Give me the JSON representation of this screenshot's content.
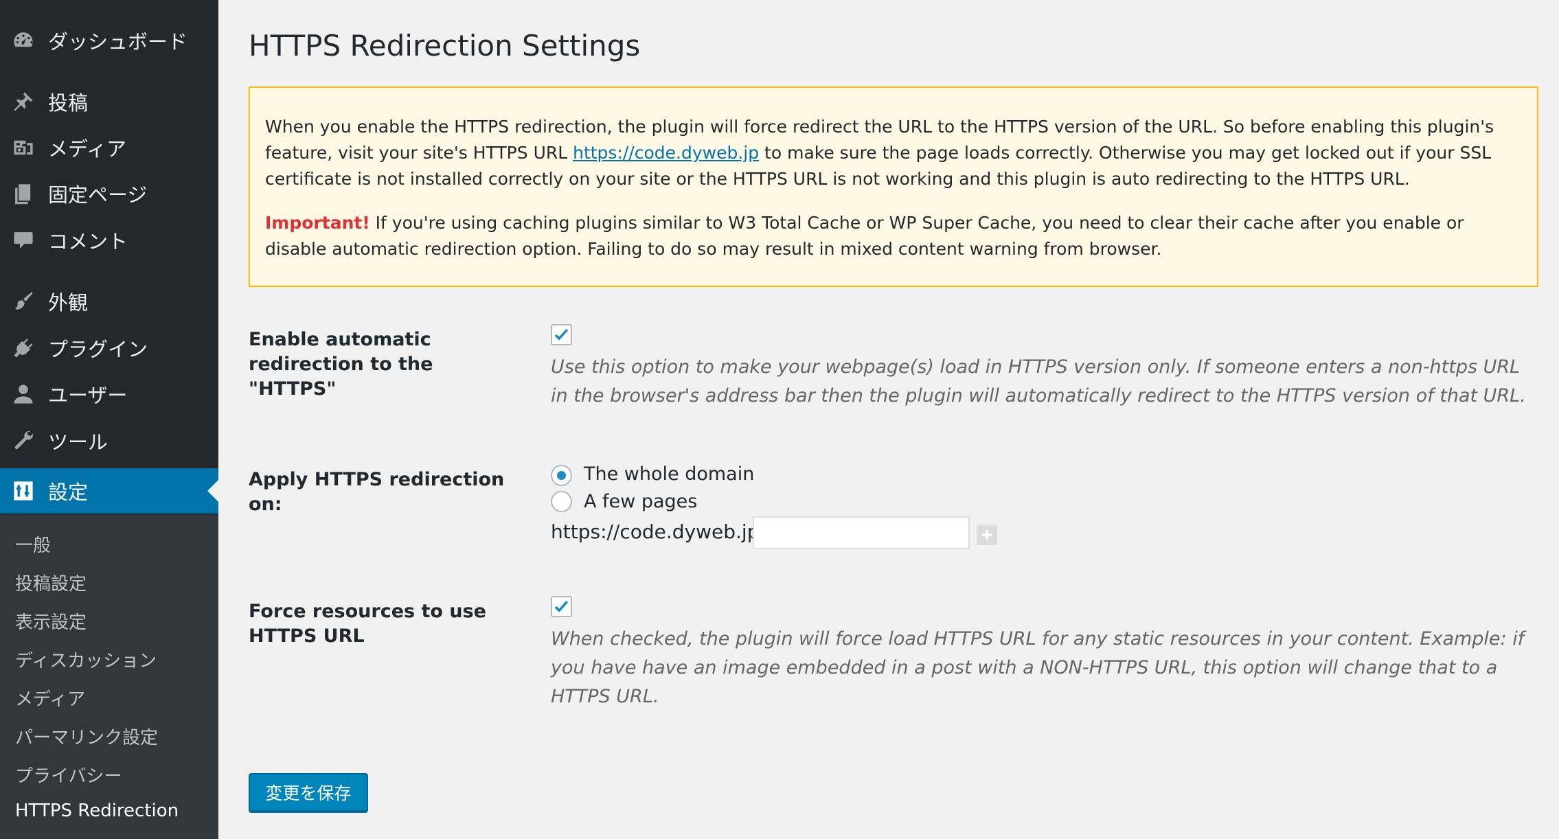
{
  "sidebar": {
    "items": [
      {
        "label": "ダッシュボード",
        "icon": "dashboard-icon"
      },
      {
        "label": "投稿",
        "icon": "pushpin-icon"
      },
      {
        "label": "メディア",
        "icon": "media-icon"
      },
      {
        "label": "固定ページ",
        "icon": "pages-icon"
      },
      {
        "label": "コメント",
        "icon": "comment-icon"
      },
      {
        "label": "外観",
        "icon": "paintbrush-icon"
      },
      {
        "label": "プラグイン",
        "icon": "plugin-icon"
      },
      {
        "label": "ユーザー",
        "icon": "user-icon"
      },
      {
        "label": "ツール",
        "icon": "wrench-icon"
      },
      {
        "label": "設定",
        "icon": "settings-icon",
        "active": true
      }
    ],
    "submenu": [
      "一般",
      "投稿設定",
      "表示設定",
      "ディスカッション",
      "メディア",
      "パーマリンク設定",
      "プライバシー",
      "HTTPS Redirection"
    ]
  },
  "page": {
    "title": "HTTPS Redirection Settings"
  },
  "notice": {
    "text_before_link": "When you enable the HTTPS redirection, the plugin will force redirect the URL to the HTTPS version of the URL. So before enabling this plugin's feature, visit your site's HTTPS URL ",
    "link": "https://code.dyweb.jp",
    "text_after_link": " to make sure the page loads correctly. Otherwise you may get locked out if your SSL certificate is not installed correctly on your site or the HTTPS URL is not working and this plugin is auto redirecting to the HTTPS URL.",
    "important_label": "Important!",
    "important_text": " If you're using caching plugins similar to W3 Total Cache or WP Super Cache, you need to clear their cache after you enable or disable automatic redirection option. Failing to do so may result in mixed content warning from browser."
  },
  "settings": {
    "auto_redirect": {
      "label": "Enable automatic redirection to the \"HTTPS\"",
      "checked": true,
      "description": "Use this option to make your webpage(s) load in HTTPS version only. If someone enters a non-https URL in the browser's address bar then the plugin will automatically redirect to the HTTPS version of that URL."
    },
    "apply_on": {
      "label": "Apply HTTPS redirection on:",
      "options": [
        "The whole domain",
        "A few pages"
      ],
      "selected": "The whole domain",
      "url_prefix": "https://code.dyweb.jp/",
      "url_value": ""
    },
    "force_resources": {
      "label": "Force resources to use HTTPS URL",
      "checked": true,
      "description": "When checked, the plugin will force load HTTPS URL for any static resources in your content. Example: if you have have an image embedded in a post with a NON-HTTPS URL, this option will change that to a HTTPS URL."
    }
  },
  "save_button": {
    "label": "変更を保存"
  },
  "colors": {
    "sidebar_bg": "#23282d",
    "submenu_bg": "#32373c",
    "accent": "#0073aa",
    "notice_bg": "#fff8e5",
    "notice_border": "#ffb900",
    "important": "#dc3232"
  }
}
